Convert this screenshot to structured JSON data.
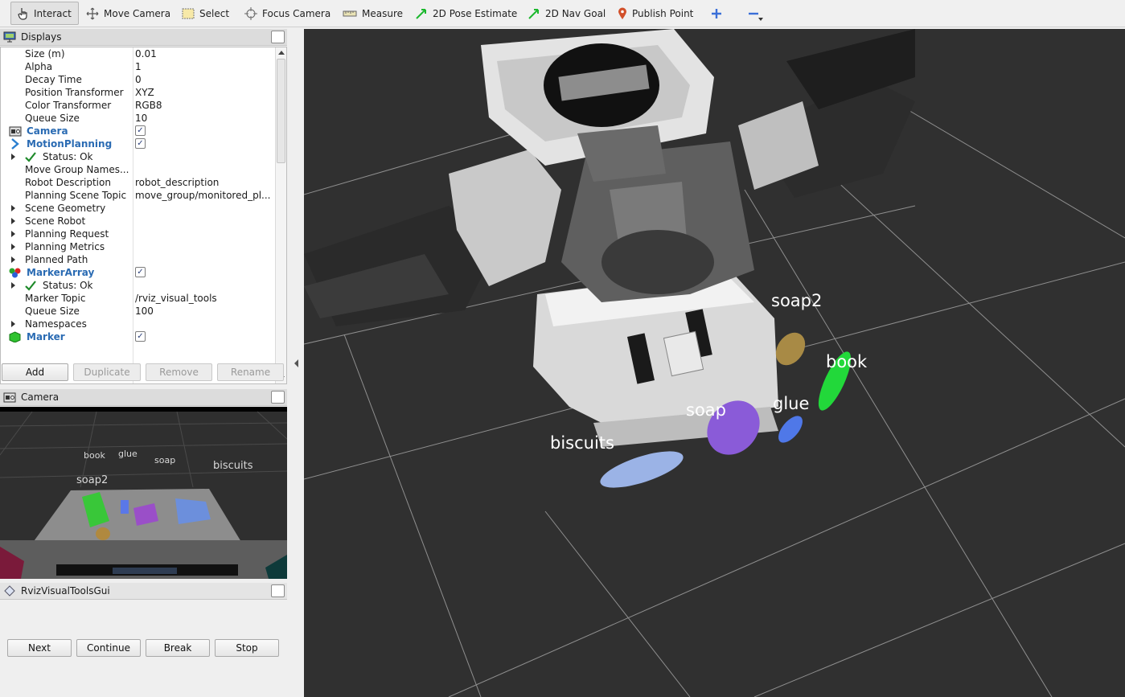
{
  "toolbar": {
    "interact": "Interact",
    "move_camera": "Move Camera",
    "select": "Select",
    "focus_camera": "Focus Camera",
    "measure": "Measure",
    "pose_estimate": "2D Pose Estimate",
    "nav_goal": "2D Nav Goal",
    "publish_point": "Publish Point"
  },
  "displays": {
    "title": "Displays",
    "rows": [
      {
        "name": "Size (m)",
        "value": "0.01"
      },
      {
        "name": "Alpha",
        "value": "1"
      },
      {
        "name": "Decay Time",
        "value": "0"
      },
      {
        "name": "Position Transformer",
        "value": "XYZ"
      },
      {
        "name": "Color Transformer",
        "value": "RGB8"
      },
      {
        "name": "Queue Size",
        "value": "10"
      },
      {
        "name": "Camera",
        "value": ""
      },
      {
        "name": "MotionPlanning",
        "value": ""
      },
      {
        "name": "Status: Ok",
        "value": ""
      },
      {
        "name": "Move Group Names...",
        "value": ""
      },
      {
        "name": "Robot Description",
        "value": "robot_description"
      },
      {
        "name": "Planning Scene Topic",
        "value": "move_group/monitored_pl..."
      },
      {
        "name": "Scene Geometry",
        "value": ""
      },
      {
        "name": "Scene Robot",
        "value": ""
      },
      {
        "name": "Planning Request",
        "value": ""
      },
      {
        "name": "Planning Metrics",
        "value": ""
      },
      {
        "name": "Planned Path",
        "value": ""
      },
      {
        "name": "MarkerArray",
        "value": ""
      },
      {
        "name": "Status: Ok",
        "value": ""
      },
      {
        "name": "Marker Topic",
        "value": "/rviz_visual_tools"
      },
      {
        "name": "Queue Size",
        "value": "100"
      },
      {
        "name": "Namespaces",
        "value": ""
      },
      {
        "name": "Marker",
        "value": ""
      }
    ],
    "buttons": {
      "add": "Add",
      "duplicate": "Duplicate",
      "remove": "Remove",
      "rename": "Rename"
    }
  },
  "camera_panel": {
    "title": "Camera",
    "labels": {
      "book": "book",
      "glue": "glue",
      "soap": "soap",
      "biscuits": "biscuits",
      "soap2": "soap2"
    }
  },
  "rviz_gui": {
    "title": "RvizVisualToolsGui",
    "buttons": {
      "next": "Next",
      "continue": "Continue",
      "break": "Break",
      "stop": "Stop"
    }
  },
  "viewport": {
    "labels": {
      "soap2": "soap2",
      "book": "book",
      "glue": "glue",
      "soap": "soap",
      "biscuits": "biscuits"
    }
  },
  "colors": {
    "biscuits": "#9bb3e6",
    "soap": "#8a5bd8",
    "glue": "#4f78e8",
    "book": "#22d83a",
    "soap2": "#a88a45",
    "link_blue": "#2a6bb3"
  }
}
